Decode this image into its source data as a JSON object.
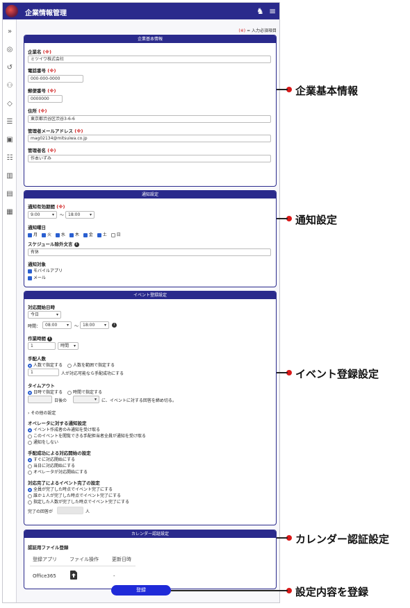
{
  "header": {
    "title": "企業情報管理"
  },
  "required_note": {
    "mark": "(※)",
    "text": "= 入力必須項目"
  },
  "req_mark": "(※)",
  "company": {
    "title": "企業基本情報",
    "name_label": "企業名",
    "name_value": "ミツイワ株式会社",
    "phone_label": "電話番号",
    "phone_value": "000-000-0000",
    "zip_label": "郵便番号",
    "zip_value": "0000000",
    "address_label": "住所",
    "address_value": "東京都渋谷区渋谷3-6-6",
    "email_label": "管理者メールアドレス",
    "email_value": "mag02134@mitsuiwa.co.jp",
    "manager_label": "管理者名",
    "manager_value": "作本いずみ"
  },
  "notify": {
    "title": "通知設定",
    "period_label": "通知有効期間",
    "from": "9:00",
    "tilde": "〜",
    "to": "18:00",
    "days_label": "通知曜日",
    "days": [
      "月",
      "火",
      "水",
      "木",
      "金",
      "土",
      "日"
    ],
    "exclude_label": "スケジュール除外文言",
    "exclude_value": "有休",
    "target_label": "通知対象",
    "target_app": "モバイルアプリ",
    "target_mail": "メール"
  },
  "event": {
    "title": "イベント登録設定",
    "start_label": "対応開始日時",
    "start_day": "今日",
    "time_label": "時間：",
    "time_from": "08:00",
    "tilde": "〜",
    "time_to": "18:00",
    "work_label": "作業時間",
    "work_value": "1",
    "work_unit": "時間",
    "arrange_label": "手配人数",
    "arrange_opt1": "人数で指定する",
    "arrange_opt2": "人数を範囲で指定する",
    "arrange_value": "1",
    "arrange_suffix": "人が対応可能なら手配成功にする",
    "timeout_label": "タイムアウト",
    "timeout_opt1": "日時で指定する",
    "timeout_opt2": "時間で指定する",
    "timeout_days": "日後の",
    "timeout_suffix": "に、イベントに対する回答を締め切る。",
    "other_settings": "その他の設定",
    "op_notify_label": "オペレータに対する通知設定",
    "op_notify_opts": [
      "イベント作成者のみ通知を受け取る",
      "このイベントを閲覧できる手配担当者全員が通知を受け取る",
      "通知をしない"
    ],
    "arrange_start_label": "手配成功による対応開始の設定",
    "arrange_start_opts": [
      "すぐに対応開始にする",
      "当日に対応開始にする",
      "オペレータが対応開始にする"
    ],
    "complete_label": "対応完了によるイベント完了の設定",
    "complete_opts": [
      "全員が完了した時点でイベント完了にする",
      "誰か１人が完了した時点でイベント完了にする",
      "指定した人数が完了した時点でイベント完了にする"
    ],
    "complete_prefix": "完了の回答が",
    "complete_suffix": "人"
  },
  "calendar": {
    "title": "カレンダー認証設定",
    "file_label": "認証用ファイル登録",
    "headers": [
      "登録アプリ",
      "ファイル操作",
      "更新日時"
    ],
    "row": {
      "app": "Office365",
      "updated": "-"
    }
  },
  "submit_label": "登録",
  "annotations": {
    "company": "企業基本情報",
    "notify": "通知設定",
    "event": "イベント登録設定",
    "calendar": "カレンダー認証設定",
    "submit": "設定内容を登録"
  },
  "colors": {
    "accent": "#2a2a8c",
    "button": "#1f2ad8",
    "required": "#d02020",
    "annotation_dot": "#d81818"
  }
}
